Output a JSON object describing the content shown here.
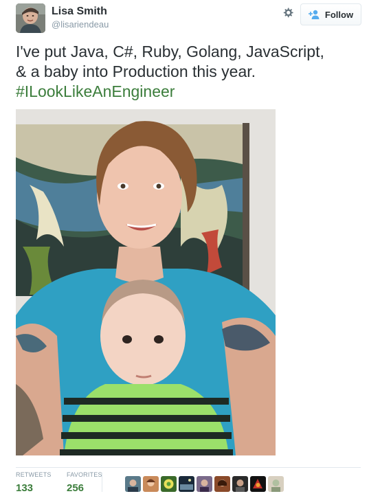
{
  "user": {
    "display_name": "Lisa Smith",
    "screen_name": "@lisariendeau"
  },
  "actions": {
    "follow_label": "Follow",
    "settings_icon": "gear-icon",
    "follow_icon": "add-user-icon"
  },
  "tweet": {
    "line1": "I've put Java, C#, Ruby, Golang, JavaScript,",
    "line2": "& a baby into Production this year.",
    "hashtag": "#ILookLikeAnEngineer"
  },
  "stats": {
    "retweets_label": "RETWEETS",
    "retweets_count": "133",
    "favorites_label": "FAVORITES",
    "favorites_count": "256"
  },
  "colors": {
    "link_green": "#3b7d3b",
    "muted": "#8899a6",
    "text": "#292f33",
    "border": "#e1e8ed"
  }
}
